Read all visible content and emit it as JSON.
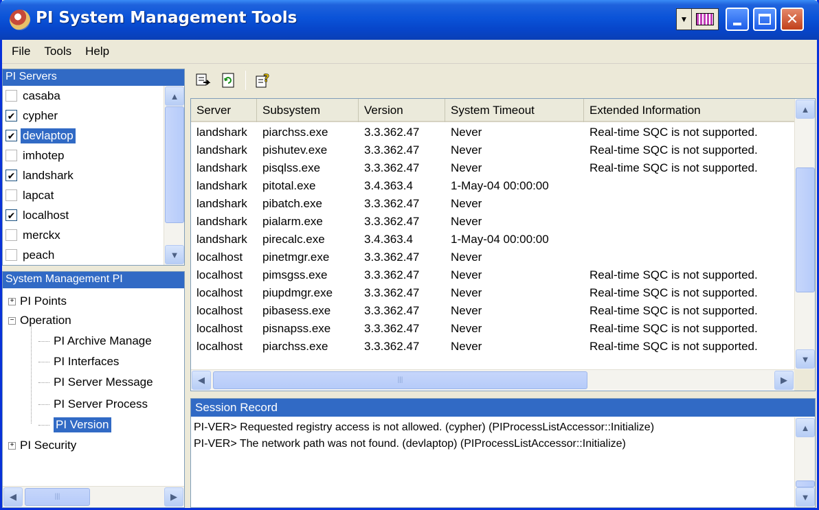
{
  "window": {
    "title": "PI System Management Tools",
    "icon": "pi-logo-icon",
    "controls": [
      "minimize",
      "maximize",
      "close"
    ]
  },
  "menu": [
    "File",
    "Tools",
    "Help"
  ],
  "servers_panel": {
    "header": "PI Servers",
    "items": [
      {
        "name": "casaba",
        "checked": false,
        "selected": false
      },
      {
        "name": "cypher",
        "checked": true,
        "selected": false
      },
      {
        "name": "devlaptop",
        "checked": true,
        "selected": true
      },
      {
        "name": "imhotep",
        "checked": false,
        "selected": false
      },
      {
        "name": "landshark",
        "checked": true,
        "selected": false
      },
      {
        "name": "lapcat",
        "checked": false,
        "selected": false
      },
      {
        "name": "localhost",
        "checked": true,
        "selected": false
      },
      {
        "name": "merckx",
        "checked": false,
        "selected": false
      },
      {
        "name": "peach",
        "checked": false,
        "selected": false
      }
    ]
  },
  "tree_panel": {
    "header": "System Management PI",
    "nodes": [
      {
        "label": "PI Points",
        "level": 0,
        "expander": "+"
      },
      {
        "label": "Operation",
        "level": 0,
        "expander": "-"
      },
      {
        "label": "PI Archive Manage",
        "level": 1
      },
      {
        "label": "PI Interfaces",
        "level": 1
      },
      {
        "label": "PI Server Message",
        "level": 1
      },
      {
        "label": "PI Server Process",
        "level": 1
      },
      {
        "label": "PI Version",
        "level": 1,
        "selected": true
      },
      {
        "label": "PI Security",
        "level": 0,
        "expander": "+"
      }
    ]
  },
  "toolbar": {
    "buttons": [
      "export-icon",
      "refresh-icon",
      "help-icon"
    ]
  },
  "grid": {
    "columns": [
      "Server",
      "Subsystem",
      "Version",
      "System Timeout",
      "Extended Information"
    ],
    "rows": [
      [
        "landshark",
        "piarchss.exe",
        "3.3.362.47",
        "Never",
        "Real-time SQC is not supported."
      ],
      [
        "landshark",
        "pishutev.exe",
        "3.3.362.47",
        "Never",
        "Real-time SQC is not supported."
      ],
      [
        "landshark",
        "pisqlss.exe",
        "3.3.362.47",
        "Never",
        "Real-time SQC is not supported."
      ],
      [
        "landshark",
        "pitotal.exe",
        "3.4.363.4",
        "1-May-04 00:00:00",
        ""
      ],
      [
        "landshark",
        "pibatch.exe",
        "3.3.362.47",
        "Never",
        ""
      ],
      [
        "landshark",
        "pialarm.exe",
        "3.3.362.47",
        "Never",
        ""
      ],
      [
        "landshark",
        "pirecalc.exe",
        "3.4.363.4",
        "1-May-04 00:00:00",
        ""
      ],
      [
        "localhost",
        "pinetmgr.exe",
        "3.3.362.47",
        "Never",
        ""
      ],
      [
        "localhost",
        "pimsgss.exe",
        "3.3.362.47",
        "Never",
        "Real-time SQC is not supported."
      ],
      [
        "localhost",
        "piupdmgr.exe",
        "3.3.362.47",
        "Never",
        "Real-time SQC is not supported."
      ],
      [
        "localhost",
        "pibasess.exe",
        "3.3.362.47",
        "Never",
        "Real-time SQC is not supported."
      ],
      [
        "localhost",
        "pisnapss.exe",
        "3.3.362.47",
        "Never",
        "Real-time SQC is not supported."
      ],
      [
        "localhost",
        "piarchss.exe",
        "3.3.362.47",
        "Never",
        "Real-time SQC is not supported."
      ]
    ]
  },
  "session": {
    "header": "Session Record",
    "lines": [
      "PI-VER> Requested registry access is not allowed. (cypher) (PIProcessListAccessor::Initialize)",
      "PI-VER> The network path was not found. (devlaptop) (PIProcessListAccessor::Initialize)"
    ]
  },
  "colors": {
    "titlebar": "#0a53d8",
    "selection": "#316ac5",
    "face": "#ece9d8"
  }
}
